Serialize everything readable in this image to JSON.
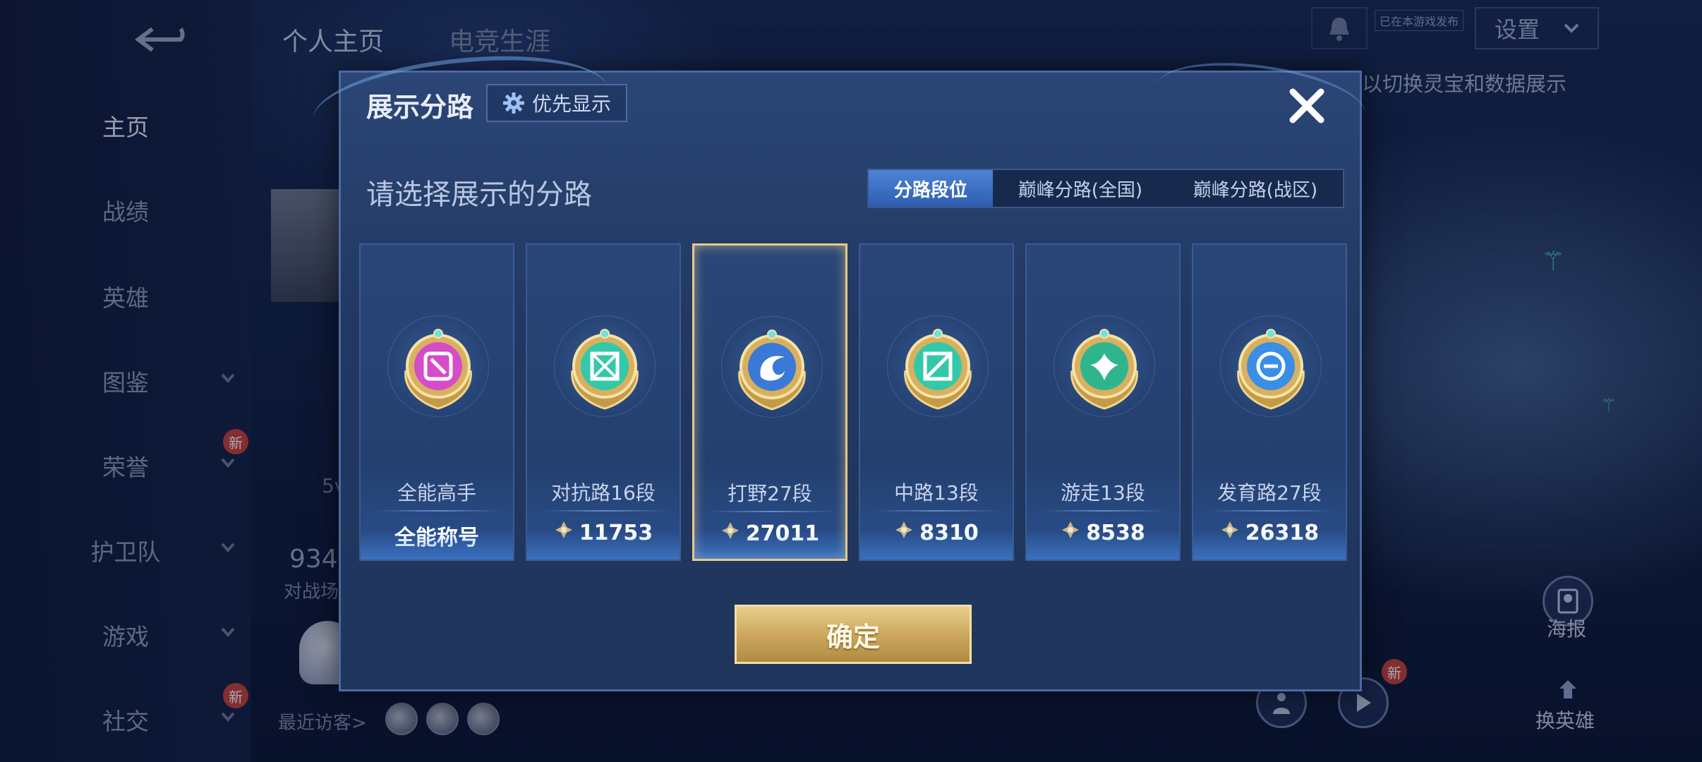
{
  "top_tabs": [
    "个人主页",
    "电竞生涯"
  ],
  "sidebar": {
    "items": [
      {
        "label": "主页",
        "has_chevron": false,
        "new": false
      },
      {
        "label": "战绩",
        "has_chevron": false,
        "new": false
      },
      {
        "label": "英雄",
        "has_chevron": false,
        "new": false
      },
      {
        "label": "图鉴",
        "has_chevron": true,
        "new": false
      },
      {
        "label": "荣誉",
        "has_chevron": true,
        "new": true
      },
      {
        "label": "护卫队",
        "has_chevron": true,
        "new": false
      },
      {
        "label": "游戏",
        "has_chevron": true,
        "new": false
      },
      {
        "label": "社交",
        "has_chevron": true,
        "new": true
      }
    ],
    "new_badge": "新"
  },
  "header": {
    "settings_label": "设置",
    "small_badge": "已在本游戏发布",
    "hint": "以切换灵宝和数据展示"
  },
  "profile": {
    "number": "934",
    "sub_label": "对战场",
    "mode_label": "5v",
    "visitors_label": "最近访客>"
  },
  "right_buttons": {
    "poster_label": "海报",
    "change_hero_label": "换英雄",
    "new_badge": "新"
  },
  "modal": {
    "title": "展示分路",
    "priority_label": "优先显示",
    "subtitle": "请选择展示的分路",
    "segments": [
      "分路段位",
      "巅峰分路(全国)",
      "巅峰分路(战区)"
    ],
    "active_segment": 0,
    "cards": [
      {
        "name": "全能高手",
        "score": "全能称号",
        "show_icon": false,
        "emblem": "allround-emblem-icon",
        "color": "#d54cc9"
      },
      {
        "name": "对抗路16段",
        "score": "11753",
        "show_icon": true,
        "emblem": "clash-lane-emblem-icon",
        "color": "#33c9a8"
      },
      {
        "name": "打野27段",
        "score": "27011",
        "show_icon": true,
        "emblem": "jungle-emblem-icon",
        "color": "#3a79d6"
      },
      {
        "name": "中路13段",
        "score": "8310",
        "show_icon": true,
        "emblem": "mid-lane-emblem-icon",
        "color": "#33c9a8"
      },
      {
        "name": "游走13段",
        "score": "8538",
        "show_icon": true,
        "emblem": "roam-emblem-icon",
        "color": "#2fb58e"
      },
      {
        "name": "发育路27段",
        "score": "26318",
        "show_icon": true,
        "emblem": "farm-lane-emblem-icon",
        "color": "#3a8ee6"
      }
    ],
    "selected_card": 2,
    "confirm_label": "确定"
  },
  "colors": {
    "accent_gold": "#e7c98a",
    "segment_active": "#3e72c6",
    "modal_bg": "#213962"
  }
}
